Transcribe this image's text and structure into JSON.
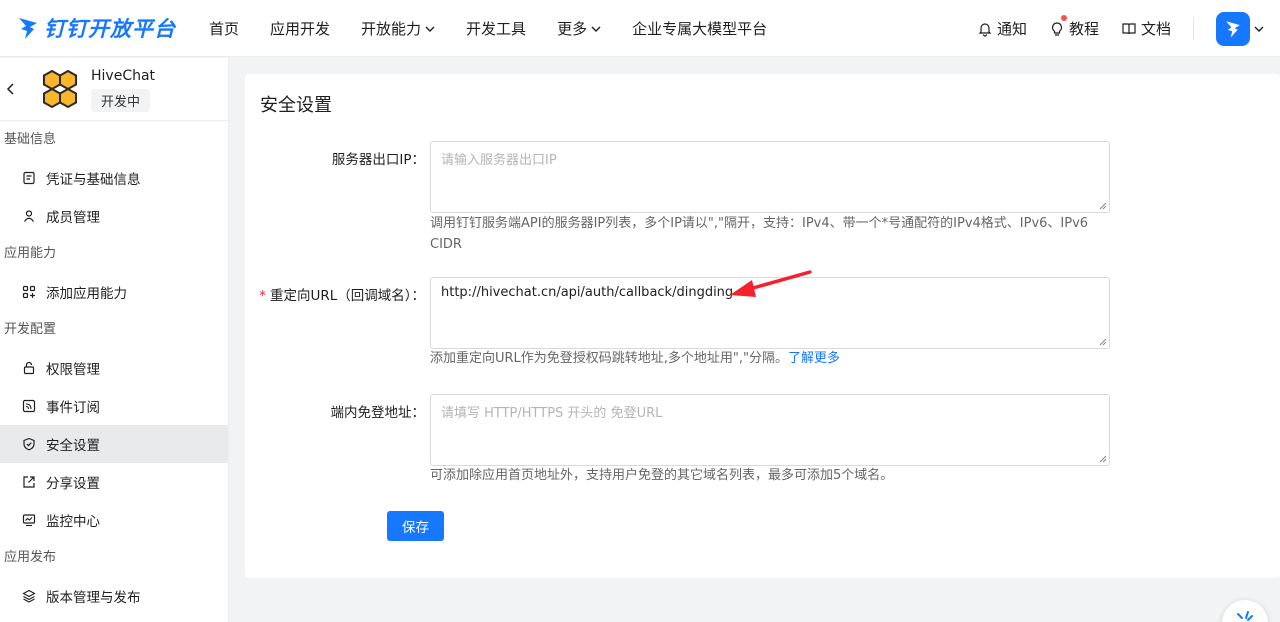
{
  "brand": {
    "name": "钉钉开放平台",
    "color": "#1677ff"
  },
  "nav": {
    "items": [
      {
        "label": "首页",
        "dropdown": false
      },
      {
        "label": "应用开发",
        "dropdown": false
      },
      {
        "label": "开放能力",
        "dropdown": true
      },
      {
        "label": "开发工具",
        "dropdown": false
      },
      {
        "label": "更多",
        "dropdown": true
      },
      {
        "label": "企业专属大模型平台",
        "dropdown": false
      }
    ],
    "right": {
      "notify": "通知",
      "tutorial": "教程",
      "docs": "文档"
    }
  },
  "app": {
    "name": "HiveChat",
    "status": "开发中"
  },
  "sidebar": {
    "groups": [
      {
        "title": "基础信息",
        "items": [
          {
            "label": "凭证与基础信息",
            "icon": "credential-icon"
          },
          {
            "label": "成员管理",
            "icon": "user-icon"
          }
        ]
      },
      {
        "title": "应用能力",
        "items": [
          {
            "label": "添加应用能力",
            "icon": "apps-add-icon"
          }
        ]
      },
      {
        "title": "开发配置",
        "items": [
          {
            "label": "权限管理",
            "icon": "lock-icon"
          },
          {
            "label": "事件订阅",
            "icon": "rss-icon"
          },
          {
            "label": "安全设置",
            "icon": "shield-icon",
            "active": true
          },
          {
            "label": "分享设置",
            "icon": "share-icon"
          },
          {
            "label": "监控中心",
            "icon": "monitor-icon"
          }
        ]
      },
      {
        "title": "应用发布",
        "items": [
          {
            "label": "版本管理与发布",
            "icon": "layers-icon"
          }
        ]
      }
    ]
  },
  "page": {
    "title": "安全设置",
    "fields": {
      "server_ip": {
        "label": "服务器出口IP：",
        "value": "",
        "placeholder": "请输入服务器出口IP",
        "help": "调用钉钉服务端API的服务器IP列表，多个IP请以\",\"隔开，支持：IPv4、带一个*号通配符的IPv4格式、IPv6、IPv6 CIDR"
      },
      "redirect_url": {
        "required_mark": "*",
        "label": "重定向URL（回调域名）：",
        "value": "http://hivechat.cn/api/auth/callback/dingding",
        "help": "添加重定向URL作为免登授权码跳转地址,多个地址用\",\"分隔。",
        "help_link": "了解更多"
      },
      "sso_url": {
        "label": "端内免登地址：",
        "value": "",
        "placeholder": "请填写 HTTP/HTTPS 开头的 免登URL",
        "help": "可添加除应用首页地址外，支持用户免登的其它域名列表，最多可添加5个域名。"
      }
    },
    "save_label": "保存"
  },
  "annotation": {
    "arrow_color": "#f5222d"
  }
}
